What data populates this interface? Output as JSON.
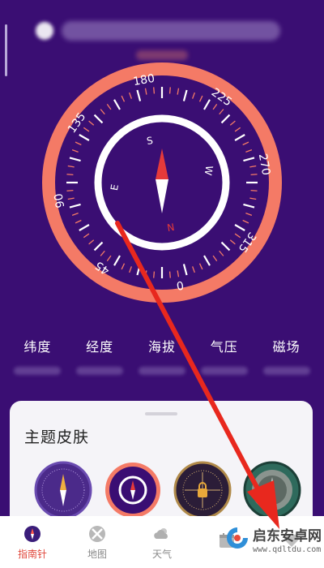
{
  "compass": {
    "degree_labels": [
      "180",
      "225",
      "270",
      "315",
      "0",
      "45",
      "90",
      "135"
    ],
    "cardinals": {
      "south": "S",
      "north": "N",
      "east": "E",
      "west": "W"
    },
    "colors": {
      "background": "#3a0e73",
      "outer_ring": "#f47a66",
      "inner_ring": "#ffffff",
      "needle_north": "#e63a3a",
      "needle_south": "#ffffff"
    }
  },
  "stats": [
    {
      "label": "纬度"
    },
    {
      "label": "经度"
    },
    {
      "label": "海拔"
    },
    {
      "label": "气压"
    },
    {
      "label": "磁场"
    }
  ],
  "theme_panel": {
    "title": "主题皮肤",
    "skins": [
      {
        "name": "purple-classic",
        "color": "#4b2a8a"
      },
      {
        "name": "coral-ring",
        "color": "#f47a66",
        "selected": true
      },
      {
        "name": "dark-gold",
        "color": "#2b1d38"
      },
      {
        "name": "green-metal",
        "color": "#2e6a5c"
      }
    ]
  },
  "bottom_nav": {
    "items": [
      {
        "label": "指南针",
        "icon": "compass-icon",
        "active": true
      },
      {
        "label": "地图",
        "icon": "map-icon"
      },
      {
        "label": "天气",
        "icon": "weather-icon"
      },
      {
        "label": "",
        "icon": "calendar-icon"
      },
      {
        "label": "",
        "icon": "heart-icon"
      }
    ]
  },
  "watermark": {
    "title": "启东安卓网",
    "url": "www.qdltdu.com"
  }
}
